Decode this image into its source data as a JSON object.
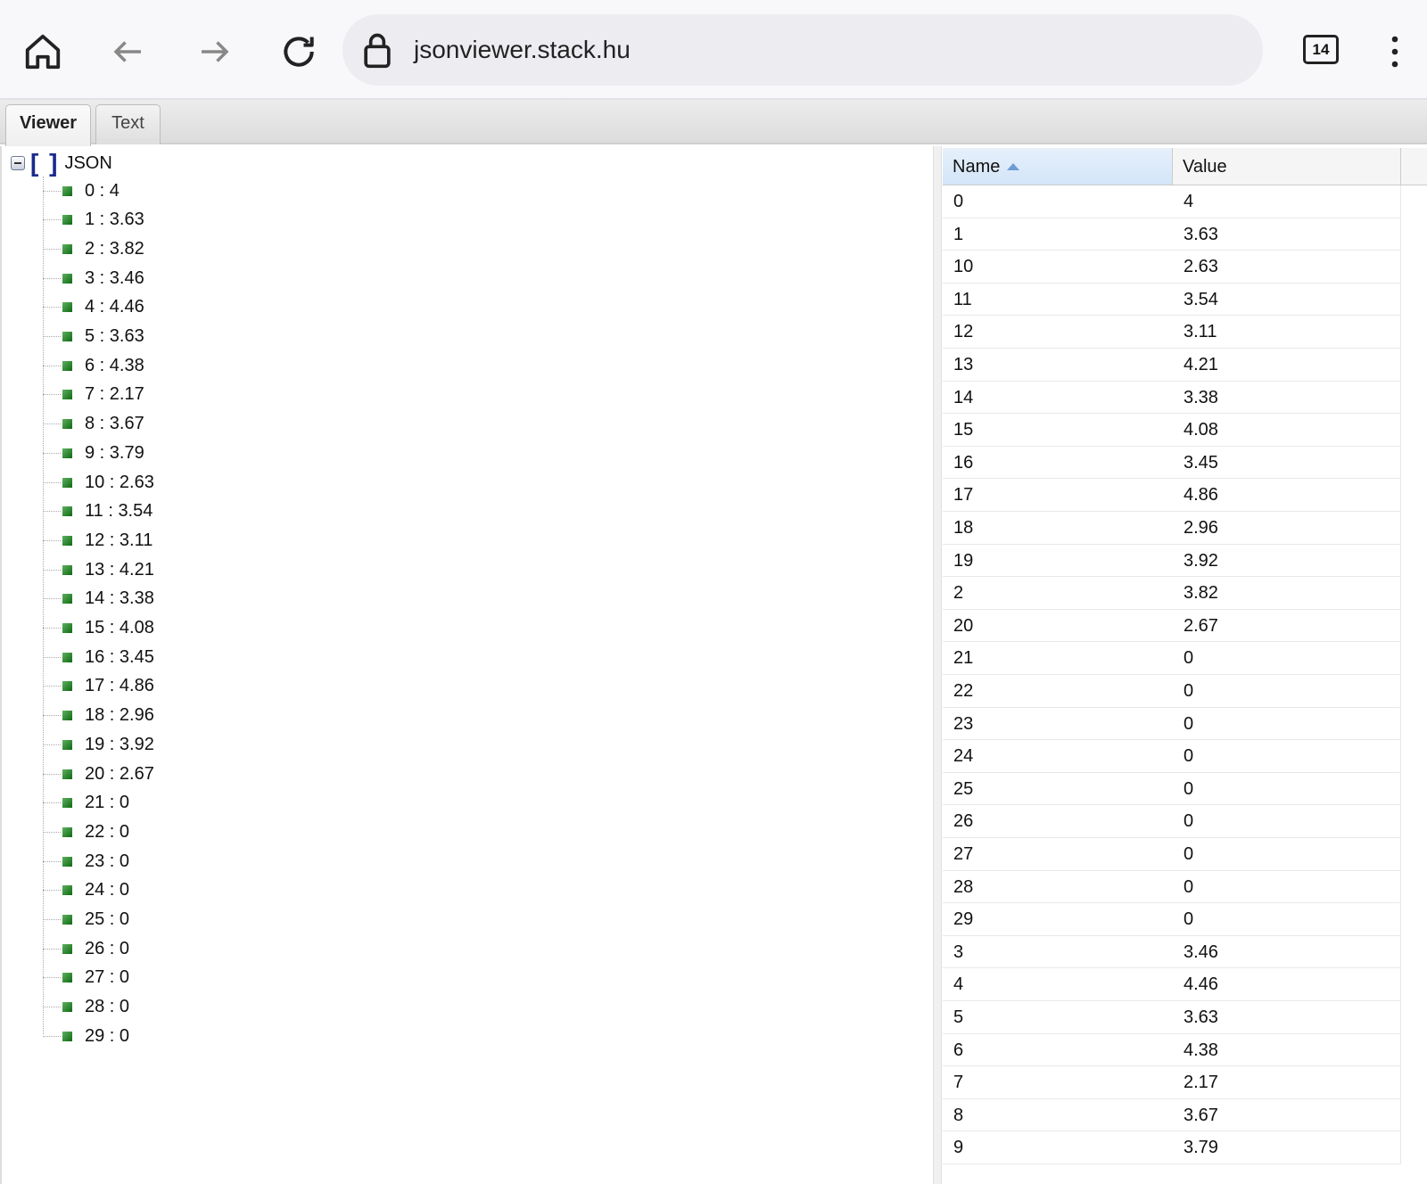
{
  "browser": {
    "url": "jsonviewer.stack.hu",
    "tab_count": "14"
  },
  "tabs": [
    {
      "label": "Viewer",
      "active": true
    },
    {
      "label": "Text",
      "active": false
    }
  ],
  "tree": {
    "root_label": "JSON",
    "items": [
      {
        "k": "0",
        "v": "4"
      },
      {
        "k": "1",
        "v": "3.63"
      },
      {
        "k": "2",
        "v": "3.82"
      },
      {
        "k": "3",
        "v": "3.46"
      },
      {
        "k": "4",
        "v": "4.46"
      },
      {
        "k": "5",
        "v": "3.63"
      },
      {
        "k": "6",
        "v": "4.38"
      },
      {
        "k": "7",
        "v": "2.17"
      },
      {
        "k": "8",
        "v": "3.67"
      },
      {
        "k": "9",
        "v": "3.79"
      },
      {
        "k": "10",
        "v": "2.63"
      },
      {
        "k": "11",
        "v": "3.54"
      },
      {
        "k": "12",
        "v": "3.11"
      },
      {
        "k": "13",
        "v": "4.21"
      },
      {
        "k": "14",
        "v": "3.38"
      },
      {
        "k": "15",
        "v": "4.08"
      },
      {
        "k": "16",
        "v": "3.45"
      },
      {
        "k": "17",
        "v": "4.86"
      },
      {
        "k": "18",
        "v": "2.96"
      },
      {
        "k": "19",
        "v": "3.92"
      },
      {
        "k": "20",
        "v": "2.67"
      },
      {
        "k": "21",
        "v": "0"
      },
      {
        "k": "22",
        "v": "0"
      },
      {
        "k": "23",
        "v": "0"
      },
      {
        "k": "24",
        "v": "0"
      },
      {
        "k": "25",
        "v": "0"
      },
      {
        "k": "26",
        "v": "0"
      },
      {
        "k": "27",
        "v": "0"
      },
      {
        "k": "28",
        "v": "0"
      },
      {
        "k": "29",
        "v": "0"
      }
    ]
  },
  "grid": {
    "headers": {
      "name": "Name",
      "value": "Value"
    },
    "rows": [
      [
        "0",
        "4"
      ],
      [
        "1",
        "3.63"
      ],
      [
        "10",
        "2.63"
      ],
      [
        "11",
        "3.54"
      ],
      [
        "12",
        "3.11"
      ],
      [
        "13",
        "4.21"
      ],
      [
        "14",
        "3.38"
      ],
      [
        "15",
        "4.08"
      ],
      [
        "16",
        "3.45"
      ],
      [
        "17",
        "4.86"
      ],
      [
        "18",
        "2.96"
      ],
      [
        "19",
        "3.92"
      ],
      [
        "2",
        "3.82"
      ],
      [
        "20",
        "2.67"
      ],
      [
        "21",
        "0"
      ],
      [
        "22",
        "0"
      ],
      [
        "23",
        "0"
      ],
      [
        "24",
        "0"
      ],
      [
        "25",
        "0"
      ],
      [
        "26",
        "0"
      ],
      [
        "27",
        "0"
      ],
      [
        "28",
        "0"
      ],
      [
        "29",
        "0"
      ],
      [
        "3",
        "3.46"
      ],
      [
        "4",
        "4.46"
      ],
      [
        "5",
        "3.63"
      ],
      [
        "6",
        "4.38"
      ],
      [
        "7",
        "2.17"
      ],
      [
        "8",
        "3.67"
      ],
      [
        "9",
        "3.79"
      ]
    ]
  }
}
